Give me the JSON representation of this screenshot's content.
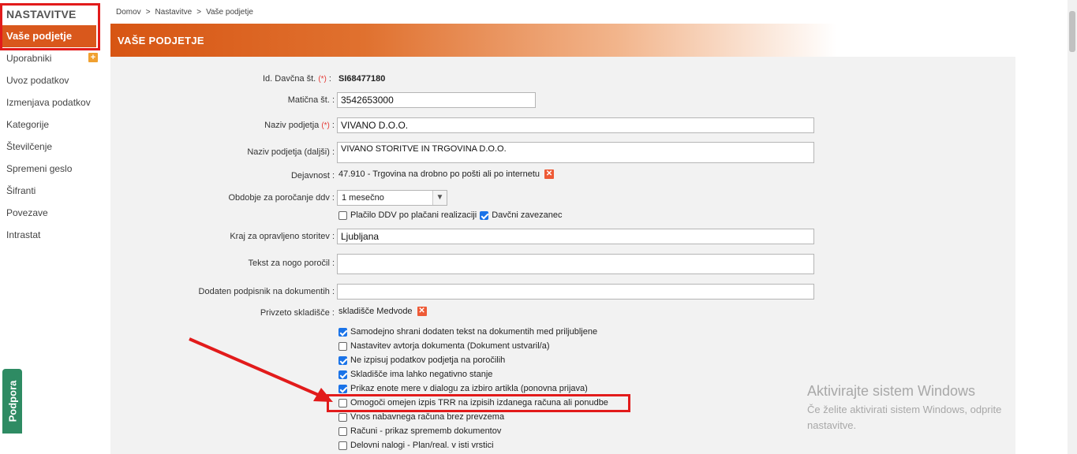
{
  "sidebar": {
    "heading": "NASTAVITVE",
    "active_item": "Vaše podjetje",
    "items": [
      "Uporabniki",
      "Uvoz podatkov",
      "Izmenjava podatkov",
      "Kategorije",
      "Številčenje",
      "Spremeni geslo",
      "Šifranti",
      "Povezave",
      "Intrastat"
    ],
    "add_icon": "+"
  },
  "support_label": "Podpora",
  "breadcrumb": {
    "items": [
      "Domov",
      "Nastavitve",
      "Vaše podjetje"
    ],
    "separator": ">"
  },
  "header": {
    "title": "VAŠE PODJETJE"
  },
  "form": {
    "required_mark": "(*)",
    "tax_id": {
      "label": "Id. Davčna št.",
      "value": "SI68477180"
    },
    "reg_no": {
      "label": "Matična št. :",
      "value": "3542653000"
    },
    "company_name": {
      "label": "Naziv podjetja",
      "value": "VIVANO D.O.O."
    },
    "company_name_ext": {
      "label": "Naziv podjetja (daljši) :",
      "value": "VIVANO STORITVE IN TRGOVINA D.O.O."
    },
    "activity": {
      "label": "Dejavnost :",
      "value": "47.910 - Trgovina na drobno po pošti ali po internetu"
    },
    "vat_period": {
      "label": "Obdobje za poročanje ddv :",
      "value": "1 mesečno"
    },
    "vat_options": [
      {
        "label": "Plačilo DDV po plačani realizaciji",
        "checked": false
      },
      {
        "label": "Davčni zavezanec",
        "checked": true
      }
    ],
    "place": {
      "label": "Kraj za opravljeno storitev :",
      "value": "Ljubljana"
    },
    "footer_text": {
      "label": "Tekst za nogo poročil :",
      "value": ""
    },
    "extra_signer": {
      "label": "Dodaten podpisnik na dokumentih :",
      "value": ""
    },
    "default_warehouse": {
      "label": "Privzeto skladišče :",
      "value": "skladišče Medvode"
    },
    "remove_icon": "✕",
    "options": [
      {
        "label": "Samodejno shrani dodaten tekst na dokumentih med priljubljene",
        "checked": true
      },
      {
        "label": "Nastavitev avtorja dokumenta (Dokument ustvaril/a)",
        "checked": false
      },
      {
        "label": "Ne izpisuj podatkov podjetja na poročilih",
        "checked": true
      },
      {
        "label": "Skladišče ima lahko negativno stanje",
        "checked": true
      },
      {
        "label": "Prikaz enote mere v dialogu za izbiro artikla (ponovna prijava)",
        "checked": true
      },
      {
        "label": "Omogoči omejen izpis TRR na izpisih izdanega računa ali ponudbe",
        "checked": false
      },
      {
        "label": "Vnos nabavnega računa brez prevzema",
        "checked": false
      },
      {
        "label": "Računi - prikaz sprememb dokumentov",
        "checked": false
      },
      {
        "label": "Delovni nalogi - Plan/real. v isti vrstici",
        "checked": false
      }
    ]
  },
  "watermark": {
    "title": "Aktivirajte sistem Windows",
    "subtitle": "Če želite aktivirati sistem Windows, odprite nastavitve."
  },
  "colors": {
    "accent": "#d9581c",
    "highlight": "#e21b1b",
    "support": "#2e8b63",
    "checkbox": "#1a73e8"
  }
}
